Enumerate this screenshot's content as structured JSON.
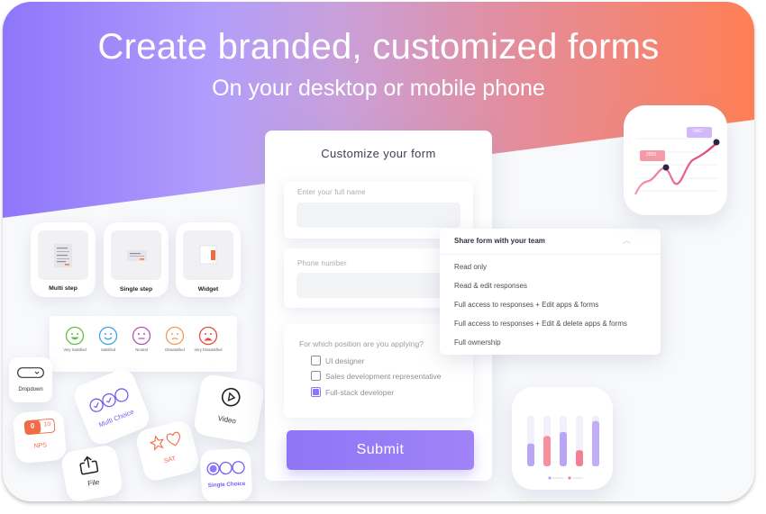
{
  "hero": {
    "title": "Create branded, customized forms",
    "subtitle": "On your desktop or mobile phone"
  },
  "colors": {
    "gradient_start": "#8e76fb",
    "gradient_end": "#ff7f55",
    "accent_purple": "#8e76fb",
    "accent_orange": "#f26b47"
  },
  "form": {
    "title": "Customize your form",
    "fields": [
      {
        "label": "Enter your full name",
        "value": ""
      },
      {
        "label": "Phone number",
        "value": ""
      }
    ],
    "question": {
      "label": "For which position are you applying?",
      "options": [
        {
          "label": "UI designer",
          "checked": false
        },
        {
          "label": "Sales development representative",
          "checked": false
        },
        {
          "label": "Full-stack developer",
          "checked": true
        }
      ]
    },
    "submit_label": "Submit"
  },
  "share_menu": {
    "title": "Share form with your team",
    "expanded": true,
    "items": [
      "Read only",
      "Read & edit responses",
      "Full access to responses + Edit apps & forms",
      "Full access to responses + Edit & delete apps & forms",
      "Full ownership"
    ]
  },
  "form_types": [
    {
      "label": "Multi step",
      "icon": "multi-step-form-icon"
    },
    {
      "label": "Single step",
      "icon": "single-step-form-icon"
    },
    {
      "label": "Widget",
      "icon": "widget-icon"
    }
  ],
  "satisfaction": [
    {
      "label": "Very Satisfied",
      "color": "#5fbf3f"
    },
    {
      "label": "Satisfied",
      "color": "#3aa7e0"
    },
    {
      "label": "Neutral",
      "color": "#b453b8"
    },
    {
      "label": "Dissatisfied",
      "color": "#f09a55"
    },
    {
      "label": "Very Dissatisfied",
      "color": "#e34b3f"
    }
  ],
  "question_types": {
    "dropdown": "Dropdown",
    "nps": "NPS",
    "nps_low": "0",
    "nps_high": "10",
    "multi_choice": "Multi Choice",
    "file": "File",
    "sat": "SAT",
    "video": "Video",
    "single_choice": "Single Choice"
  },
  "line_chart_widget": {
    "labels": [
      "2555",
      "5467"
    ]
  },
  "bar_chart_widget": {
    "bars": [
      {
        "fill": 0.45,
        "color": "#b9a5f7"
      },
      {
        "fill": 0.6,
        "color": "#f7909c"
      },
      {
        "fill": 0.68,
        "color": "#b9a5f7"
      },
      {
        "fill": 0.32,
        "color": "#f27f92"
      },
      {
        "fill": 0.9,
        "color": "#c3adf8"
      }
    ]
  }
}
